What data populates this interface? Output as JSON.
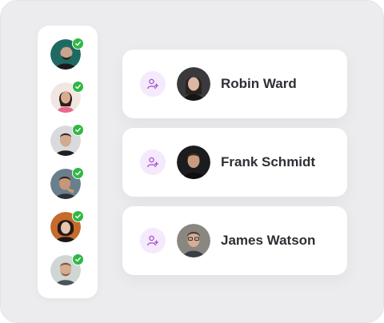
{
  "sidebar": {
    "avatars": [
      {
        "icon": "verified-check-icon",
        "accent": "#2fb845"
      },
      {
        "icon": "verified-check-icon",
        "accent": "#2fb845"
      },
      {
        "icon": "verified-check-icon",
        "accent": "#2fb845"
      },
      {
        "icon": "verified-check-icon",
        "accent": "#2fb845"
      },
      {
        "icon": "verified-check-icon",
        "accent": "#2fb845"
      },
      {
        "icon": "verified-check-icon",
        "accent": "#2fb845"
      }
    ]
  },
  "cards": [
    {
      "name": "Robin Ward",
      "action_icon": "add-user-icon"
    },
    {
      "name": "Frank Schmidt",
      "action_icon": "add-user-icon"
    },
    {
      "name": "James Watson",
      "action_icon": "add-user-icon"
    }
  ],
  "colors": {
    "background": "#ececee",
    "card": "#ffffff",
    "verified": "#2fb845",
    "add_button_bg": "#f5e9fc",
    "add_button_icon": "#a54ad1",
    "name_text": "#2f2f36"
  }
}
